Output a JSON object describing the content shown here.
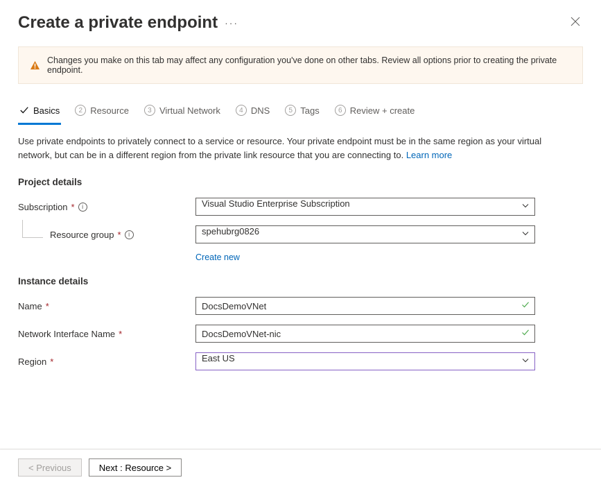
{
  "header": {
    "title": "Create a private endpoint"
  },
  "alert": {
    "message": "Changes you make on this tab may affect any configuration you've done on other tabs. Review all options prior to creating the private endpoint."
  },
  "tabs": [
    {
      "num": "",
      "label": "Basics",
      "active": true
    },
    {
      "num": "2",
      "label": "Resource"
    },
    {
      "num": "3",
      "label": "Virtual Network"
    },
    {
      "num": "4",
      "label": "DNS"
    },
    {
      "num": "5",
      "label": "Tags"
    },
    {
      "num": "6",
      "label": "Review + create"
    }
  ],
  "description": {
    "text": "Use private endpoints to privately connect to a service or resource. Your private endpoint must be in the same region as your virtual network, but can be in a different region from the private link resource that you are connecting to.  ",
    "learn_more": "Learn more"
  },
  "sections": {
    "project_details": "Project details",
    "instance_details": "Instance details"
  },
  "fields": {
    "subscription": {
      "label": "Subscription",
      "value": "Visual Studio Enterprise Subscription"
    },
    "resource_group": {
      "label": "Resource group",
      "value": "spehubrg0826",
      "create_new": "Create new"
    },
    "name": {
      "label": "Name",
      "value": "DocsDemoVNet"
    },
    "nic_name": {
      "label": "Network Interface Name",
      "value": "DocsDemoVNet-nic"
    },
    "region": {
      "label": "Region",
      "value": "East US"
    }
  },
  "footer": {
    "previous": "< Previous",
    "next": "Next : Resource >"
  }
}
